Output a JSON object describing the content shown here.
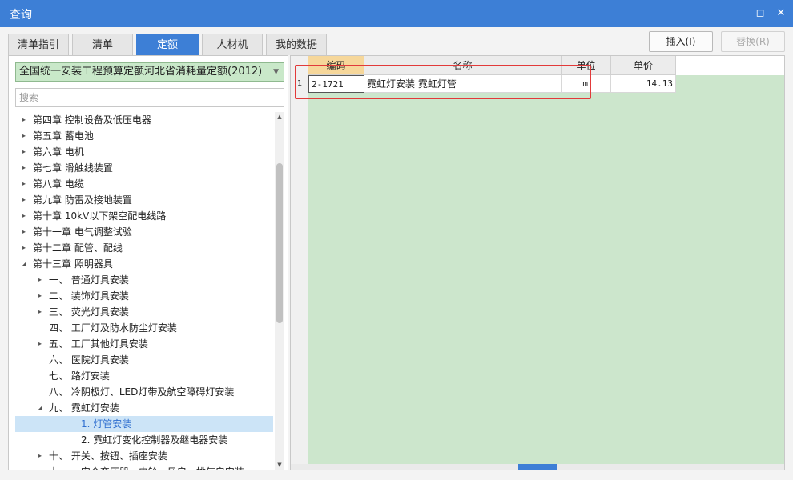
{
  "window": {
    "title": "查询",
    "restore_icon": "◻",
    "close_icon": "✕"
  },
  "tabs": [
    {
      "label": "清单指引",
      "active": false
    },
    {
      "label": "清单",
      "active": false
    },
    {
      "label": "定额",
      "active": true
    },
    {
      "label": "人材机",
      "active": false
    },
    {
      "label": "我的数据",
      "active": false
    }
  ],
  "actions": {
    "insert_label": "插入(I)",
    "replace_label": "替换(R)"
  },
  "left": {
    "library_selected": "全国统一安装工程预算定额河北省消耗量定额(2012)",
    "search_placeholder": "搜索",
    "tree": [
      {
        "label": "第四章 控制设备及低压电器",
        "level": 0,
        "arrow": "▸"
      },
      {
        "label": "第五章 蓄电池",
        "level": 0,
        "arrow": "▸"
      },
      {
        "label": "第六章 电机",
        "level": 0,
        "arrow": "▸"
      },
      {
        "label": "第七章 滑触线装置",
        "level": 0,
        "arrow": "▸"
      },
      {
        "label": "第八章 电缆",
        "level": 0,
        "arrow": "▸"
      },
      {
        "label": "第九章 防雷及接地装置",
        "level": 0,
        "arrow": "▸"
      },
      {
        "label": "第十章 10kV以下架空配电线路",
        "level": 0,
        "arrow": "▸"
      },
      {
        "label": "第十一章 电气调整试验",
        "level": 0,
        "arrow": "▸"
      },
      {
        "label": "第十二章 配管、配线",
        "level": 0,
        "arrow": "▸"
      },
      {
        "label": "第十三章 照明器具",
        "level": 0,
        "arrow": "◢"
      },
      {
        "label": "一、 普通灯具安装",
        "level": 1,
        "arrow": "▸"
      },
      {
        "label": "二、 装饰灯具安装",
        "level": 1,
        "arrow": "▸"
      },
      {
        "label": "三、 荧光灯具安装",
        "level": 1,
        "arrow": "▸"
      },
      {
        "label": "四、 工厂灯及防水防尘灯安装",
        "level": 1,
        "arrow": ""
      },
      {
        "label": "五、 工厂其他灯具安装",
        "level": 1,
        "arrow": "▸"
      },
      {
        "label": "六、 医院灯具安装",
        "level": 1,
        "arrow": ""
      },
      {
        "label": "七、 路灯安装",
        "level": 1,
        "arrow": ""
      },
      {
        "label": "八、 冷阴极灯、LED灯带及航空障碍灯安装",
        "level": 1,
        "arrow": ""
      },
      {
        "label": "九、 霓虹灯安装",
        "level": 1,
        "arrow": "◢"
      },
      {
        "label": "1. 灯管安装",
        "level": 2,
        "arrow": "",
        "selected": true
      },
      {
        "label": "2. 霓虹灯变化控制器及继电器安装",
        "level": 2,
        "arrow": ""
      },
      {
        "label": "十、 开关、按钮、插座安装",
        "level": 1,
        "arrow": "▸"
      },
      {
        "label": "十一、 安全变压器、电铃、风扇、排气扇安装",
        "level": 1,
        "arrow": "▸"
      }
    ]
  },
  "grid": {
    "headers": {
      "code": "编码",
      "name": "名称",
      "unit": "单位",
      "price": "单价"
    },
    "rows": [
      {
        "num": "1",
        "code": "2-1721",
        "name": "霓虹灯安装 霓虹灯管",
        "unit": "m",
        "price": "14.13"
      }
    ]
  },
  "colors": {
    "accent": "#3d7fd6",
    "grid_background": "#cce6cc",
    "header_highlight": "#f6d79a",
    "annotation_box": "#e23a3a"
  }
}
